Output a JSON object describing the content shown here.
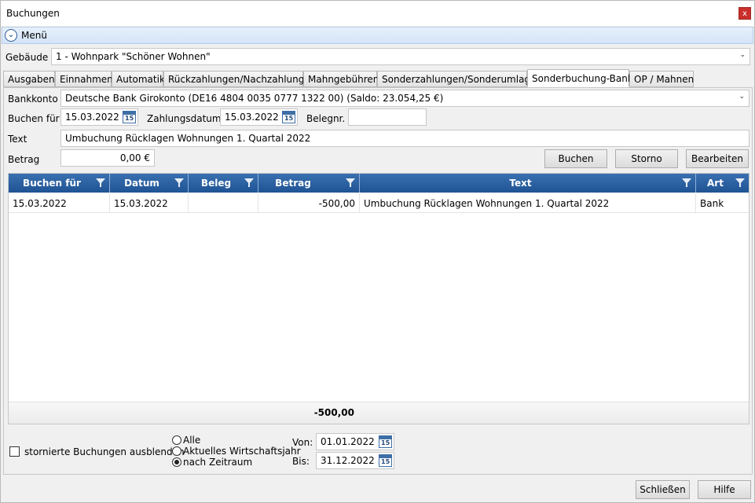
{
  "window": {
    "title": "Buchungen",
    "close_glyph": "x"
  },
  "menu": {
    "label": "Menü",
    "icon": "chevron-down-circle-icon"
  },
  "building": {
    "label": "Gebäude",
    "value": "1 - Wohnpark \"Schöner Wohnen\""
  },
  "tabs": [
    {
      "label": "Ausgaben"
    },
    {
      "label": "Einnahmen"
    },
    {
      "label": "Automatik"
    },
    {
      "label": "Rückzahlungen/Nachzahlungen"
    },
    {
      "label": "Mahngebühren"
    },
    {
      "label": "Sonderzahlungen/Sonderumlagen"
    },
    {
      "label": "Sonderbuchung-Bank",
      "active": true
    },
    {
      "label": "OP / Mahnen"
    }
  ],
  "form": {
    "bankkonto_label": "Bankkonto",
    "bankkonto_value": "Deutsche Bank Girokonto (DE16 4804 0035 0777 1322 00) (Saldo: 23.054,25 €)",
    "buchen_fuer_label": "Buchen für",
    "buchen_fuer_value": "15.03.2022",
    "zahlungsdatum_label": "Zahlungsdatum",
    "zahlungsdatum_value": "15.03.2022",
    "belegnr_label": "Belegnr.",
    "belegnr_value": "",
    "text_label": "Text",
    "text_value": "Umbuchung Rücklagen Wohnungen 1. Quartal 2022",
    "betrag_label": "Betrag",
    "betrag_value": "0,00 €",
    "calendar_day": "15"
  },
  "actions": {
    "buchen": "Buchen",
    "storno": "Storno",
    "bearbeiten": "Bearbeiten"
  },
  "table": {
    "columns": [
      "Buchen für",
      "Datum",
      "Beleg",
      "Betrag",
      "Text",
      "Art"
    ],
    "rows": [
      [
        "15.03.2022",
        "15.03.2022",
        "",
        "-500,00",
        "Umbuchung Rücklagen Wohnungen 1. Quartal 2022",
        "Bank"
      ]
    ],
    "total": "-500,00",
    "header_color": "#2a61a3"
  },
  "filter": {
    "hide_storno_label": "stornierte Buchungen ausblenden",
    "hide_storno_checked": false,
    "options": [
      {
        "label": "Alle",
        "selected": false
      },
      {
        "label": "Aktuelles Wirtschaftsjahr",
        "selected": false
      },
      {
        "label": "nach Zeitraum",
        "selected": true
      }
    ],
    "von_label": "Von:",
    "von_value": "01.01.2022",
    "bis_label": "Bis:",
    "bis_value": "31.12.2022"
  },
  "footer": {
    "schliessen": "Schließen",
    "hilfe": "Hilfe"
  }
}
